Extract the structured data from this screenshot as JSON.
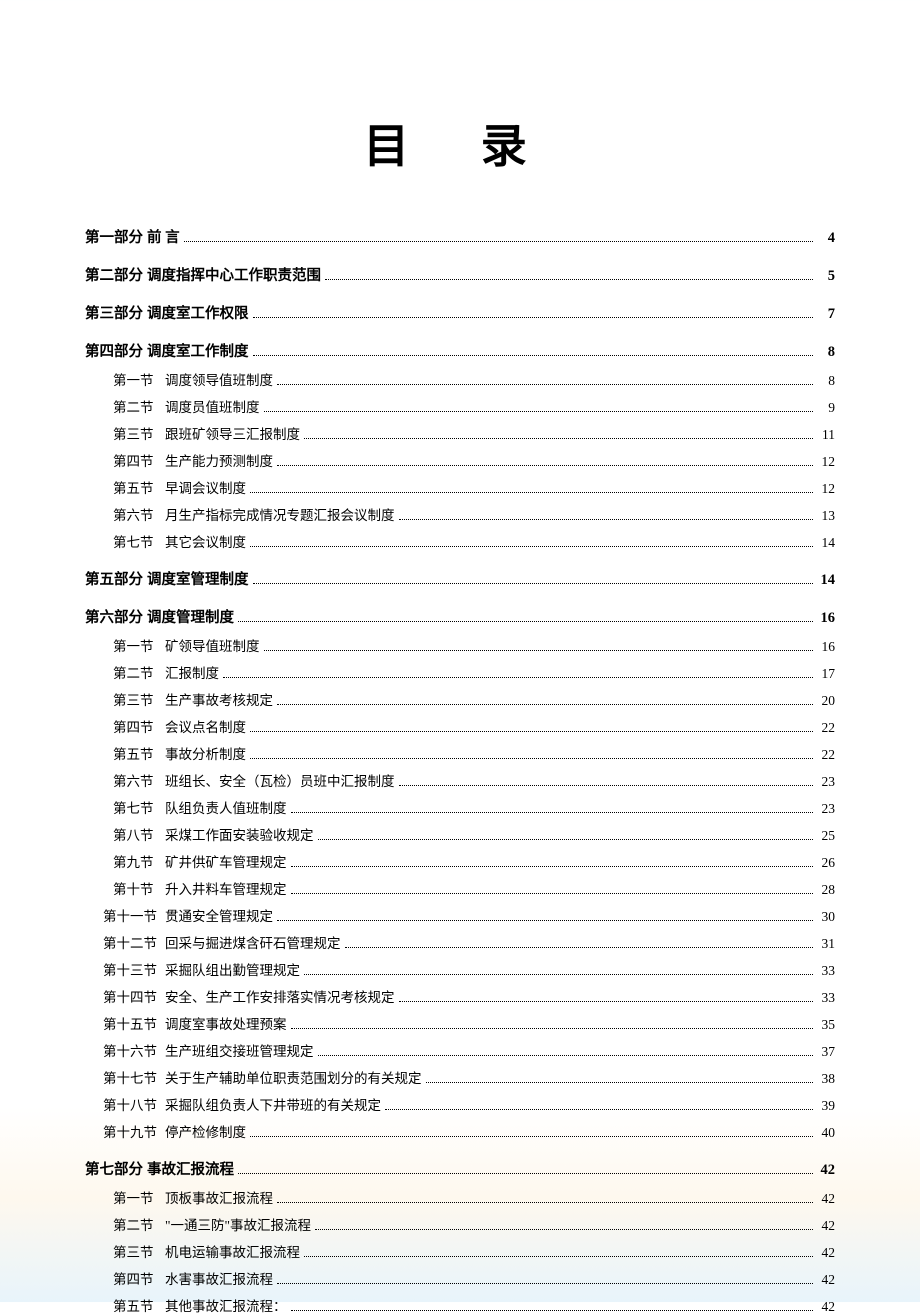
{
  "title": "目  录",
  "parts": [
    {
      "label": "第一部分",
      "title": "前    言",
      "page": "4",
      "sections": []
    },
    {
      "label": "第二部分",
      "title": "调度指挥中心工作职责范围",
      "page": "5",
      "sections": []
    },
    {
      "label": "第三部分",
      "title": "调度室工作权限",
      "page": "7",
      "sections": []
    },
    {
      "label": "第四部分",
      "title": "调度室工作制度",
      "page": "8",
      "sections": [
        {
          "label": "第一节",
          "title": "调度领导值班制度",
          "page": "8"
        },
        {
          "label": "第二节",
          "title": "调度员值班制度",
          "page": "9"
        },
        {
          "label": "第三节",
          "title": "跟班矿领导三汇报制度",
          "page": "11"
        },
        {
          "label": "第四节",
          "title": "生产能力预测制度",
          "page": "12"
        },
        {
          "label": "第五节",
          "title": "早调会议制度",
          "page": "12"
        },
        {
          "label": "第六节",
          "title": "月生产指标完成情况专题汇报会议制度",
          "page": "13"
        },
        {
          "label": "第七节",
          "title": "其它会议制度",
          "page": "14"
        }
      ]
    },
    {
      "label": "第五部分",
      "title": " 调度室管理制度",
      "page": "14",
      "sections": []
    },
    {
      "label": "第六部分",
      "title": "调度管理制度",
      "page": "16",
      "sections": [
        {
          "label": "第一节",
          "title": "矿领导值班制度",
          "page": "16"
        },
        {
          "label": "第二节",
          "title": "汇报制度",
          "page": "17"
        },
        {
          "label": "第三节",
          "title": "生产事故考核规定",
          "page": "20"
        },
        {
          "label": "第四节",
          "title": "会议点名制度",
          "page": "22"
        },
        {
          "label": "第五节",
          "title": "事故分析制度",
          "page": "22"
        },
        {
          "label": "第六节",
          "title": "班组长、安全（瓦检）员班中汇报制度",
          "page": "23"
        },
        {
          "label": "第七节",
          "title": "队组负责人值班制度",
          "page": "23"
        },
        {
          "label": "第八节",
          "title": "采煤工作面安装验收规定",
          "page": "25"
        },
        {
          "label": "第九节",
          "title": "矿井供矿车管理规定",
          "page": "26"
        },
        {
          "label": "第十节",
          "title": "升入井料车管理规定",
          "page": "28"
        },
        {
          "label": "第十一节",
          "title": "贯通安全管理规定",
          "page": "30",
          "wide": true
        },
        {
          "label": "第十二节",
          "title": "回采与掘进煤含矸石管理规定",
          "page": "31",
          "wide": true
        },
        {
          "label": "第十三节",
          "title": "采掘队组出勤管理规定",
          "page": "33",
          "wide": true
        },
        {
          "label": "第十四节",
          "title": "安全、生产工作安排落实情况考核规定",
          "page": "33",
          "wide": true
        },
        {
          "label": "第十五节",
          "title": "调度室事故处理预案",
          "page": "35",
          "wide": true
        },
        {
          "label": "第十六节",
          "title": "生产班组交接班管理规定",
          "page": "37",
          "wide": true
        },
        {
          "label": "第十七节",
          "title": "关于生产辅助单位职责范围划分的有关规定",
          "page": "38",
          "wide": true
        },
        {
          "label": "第十八节",
          "title": "采掘队组负责人下井带班的有关规定",
          "page": "39",
          "wide": true
        },
        {
          "label": "第十九节",
          "title": "停产检修制度",
          "page": "40",
          "wide": true
        }
      ]
    },
    {
      "label": "第七部分",
      "title": "事故汇报流程",
      "page": "42",
      "sections": [
        {
          "label": "第一节",
          "title": "顶板事故汇报流程",
          "page": "42"
        },
        {
          "label": "第二节",
          "title": "\"一通三防\"事故汇报流程",
          "page": "42"
        },
        {
          "label": "第三节",
          "title": "机电运输事故汇报流程",
          "page": "42"
        },
        {
          "label": "第四节",
          "title": "水害事故汇报流程",
          "page": "42"
        },
        {
          "label": "第五节",
          "title": "其他事故汇报流程：",
          "page": "42"
        }
      ]
    }
  ]
}
